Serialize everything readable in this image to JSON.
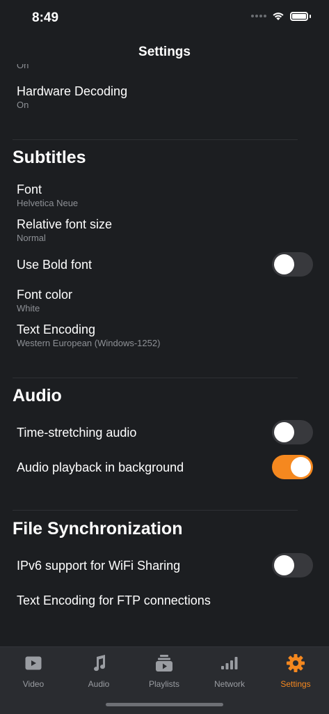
{
  "status": {
    "time": "8:49"
  },
  "nav": {
    "title": "Settings"
  },
  "cut_value": "On",
  "hardware_decoding": {
    "label": "Hardware Decoding",
    "value": "On"
  },
  "subtitles": {
    "title": "Subtitles",
    "font": {
      "label": "Font",
      "value": "Helvetica Neue"
    },
    "relative_size": {
      "label": "Relative font size",
      "value": "Normal"
    },
    "bold": {
      "label": "Use Bold font",
      "on": false
    },
    "color": {
      "label": "Font color",
      "value": "White"
    },
    "encoding": {
      "label": "Text Encoding",
      "value": "Western European (Windows-1252)"
    }
  },
  "audio": {
    "title": "Audio",
    "time_stretching": {
      "label": "Time-stretching audio",
      "on": false
    },
    "background": {
      "label": "Audio playback in background",
      "on": true
    }
  },
  "file_sync": {
    "title": "File Synchronization",
    "ipv6": {
      "label": "IPv6 support for WiFi Sharing",
      "on": false
    },
    "ftp_encoding": {
      "label": "Text Encoding for FTP connections"
    }
  },
  "tabs": [
    {
      "label": "Video",
      "icon": "video-icon",
      "active": false
    },
    {
      "label": "Audio",
      "icon": "music-note-icon",
      "active": false
    },
    {
      "label": "Playlists",
      "icon": "playlist-icon",
      "active": false
    },
    {
      "label": "Network",
      "icon": "network-bars-icon",
      "active": false
    },
    {
      "label": "Settings",
      "icon": "gear-icon",
      "active": true
    }
  ],
  "colors": {
    "accent": "#f5881f",
    "background": "#1c1e21",
    "secondary_text": "#8e9196"
  }
}
